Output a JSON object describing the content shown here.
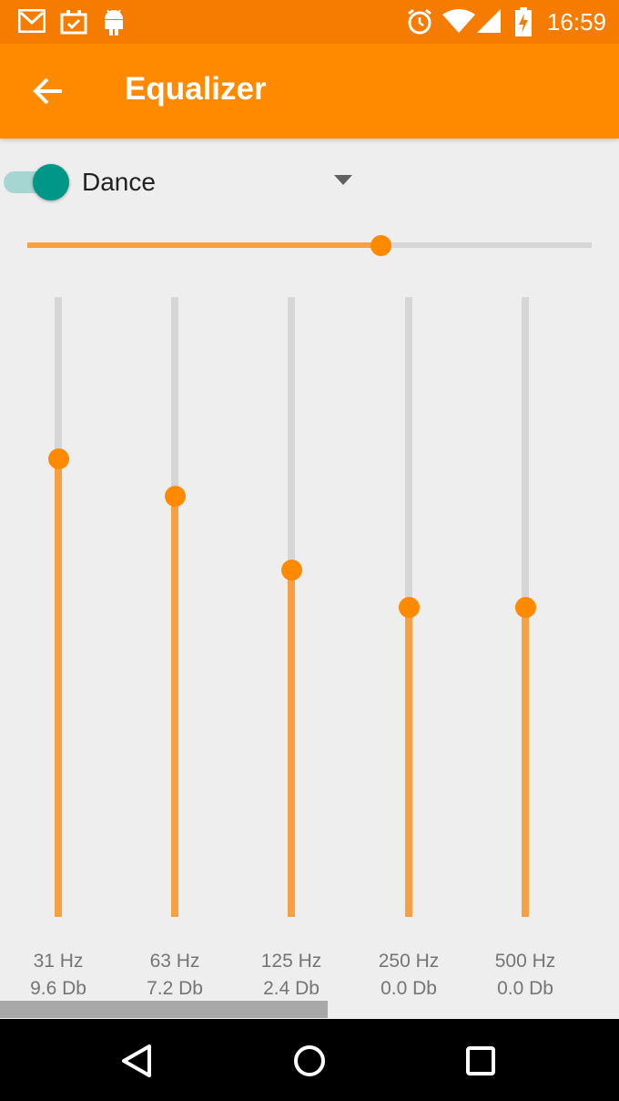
{
  "status_bar": {
    "time": "16:59",
    "left_icons": [
      "gmail-icon",
      "calendar-check-icon",
      "android-icon"
    ],
    "right_icons": [
      "alarm-icon",
      "wifi-icon",
      "signal-icon",
      "battery-charging-icon"
    ]
  },
  "app_bar": {
    "title": "Equalizer",
    "back_icon": "arrow-left-icon",
    "color": "#ff8a00"
  },
  "controls": {
    "enabled": true,
    "toggle_color": "#009688",
    "preset": "Dance",
    "master_level": 0.625
  },
  "bands": [
    {
      "freq": "31 Hz",
      "gain": "9.6 Db",
      "level": 0.74
    },
    {
      "freq": "63 Hz",
      "gain": "7.2 Db",
      "level": 0.68
    },
    {
      "freq": "125 Hz",
      "gain": "2.4 Db",
      "level": 0.56
    },
    {
      "freq": "250 Hz",
      "gain": "0.0 Db",
      "level": 0.5
    },
    {
      "freq": "500 Hz",
      "gain": "0.0 Db",
      "level": 0.5
    }
  ],
  "accent_color": "#ff8a00",
  "nav_bar": {
    "icons": [
      "back-triangle-icon",
      "home-circle-icon",
      "recents-square-icon"
    ]
  }
}
